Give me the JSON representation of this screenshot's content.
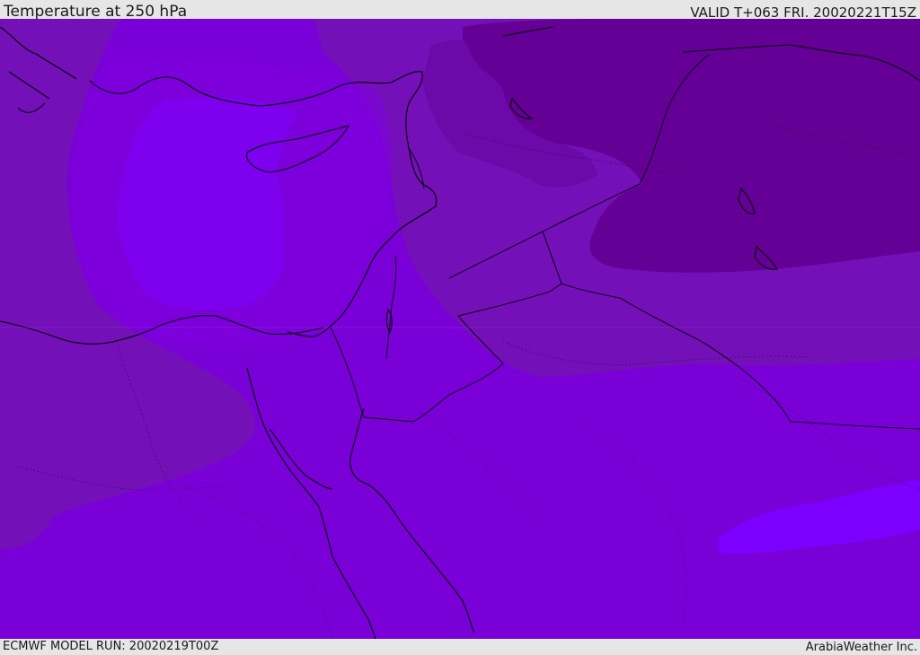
{
  "header": {
    "title": "Temperature at 250 hPa",
    "valid": "VALID T+063 FRI. 20020221T15Z"
  },
  "footer": {
    "model_run": "ECMWF MODEL RUN: 20020219T00Z",
    "provider": "ArabiaWeather Inc."
  },
  "map": {
    "field": "Temperature at 250 hPa",
    "colors": {
      "warmest": "#7b00ff",
      "mid": "#7f00e0",
      "base": "#7a00d8",
      "cool": "#7310b8",
      "cooler": "#6b0aa8",
      "coolest": "#640096",
      "coast": "#000000",
      "border": "#000000"
    }
  }
}
